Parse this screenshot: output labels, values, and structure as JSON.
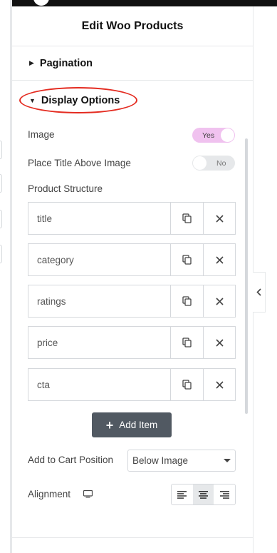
{
  "panel": {
    "title": "Edit Woo Products"
  },
  "sections": {
    "pagination": "Pagination",
    "display_options": "Display Options"
  },
  "display": {
    "image_label": "Image",
    "image_toggle": "Yes",
    "place_title_label": "Place Title Above Image",
    "place_title_toggle": "No",
    "product_structure_label": "Product Structure",
    "items": [
      {
        "title": "title"
      },
      {
        "title": "category"
      },
      {
        "title": "ratings"
      },
      {
        "title": "price"
      },
      {
        "title": "cta"
      }
    ],
    "add_item_label": "Add Item",
    "add_to_cart_label": "Add to Cart Position",
    "add_to_cart_value": "Below Image",
    "alignment_label": "Alignment"
  },
  "colors": {
    "highlight_ring": "#e42b20",
    "toggle_on": "#f0c2ef",
    "add_button": "#515962"
  },
  "icons": [
    "duplicate-icon",
    "remove-icon",
    "plus-icon",
    "desktop-icon",
    "align-left-icon",
    "align-center-icon",
    "align-right-icon",
    "chevron-left-icon"
  ]
}
